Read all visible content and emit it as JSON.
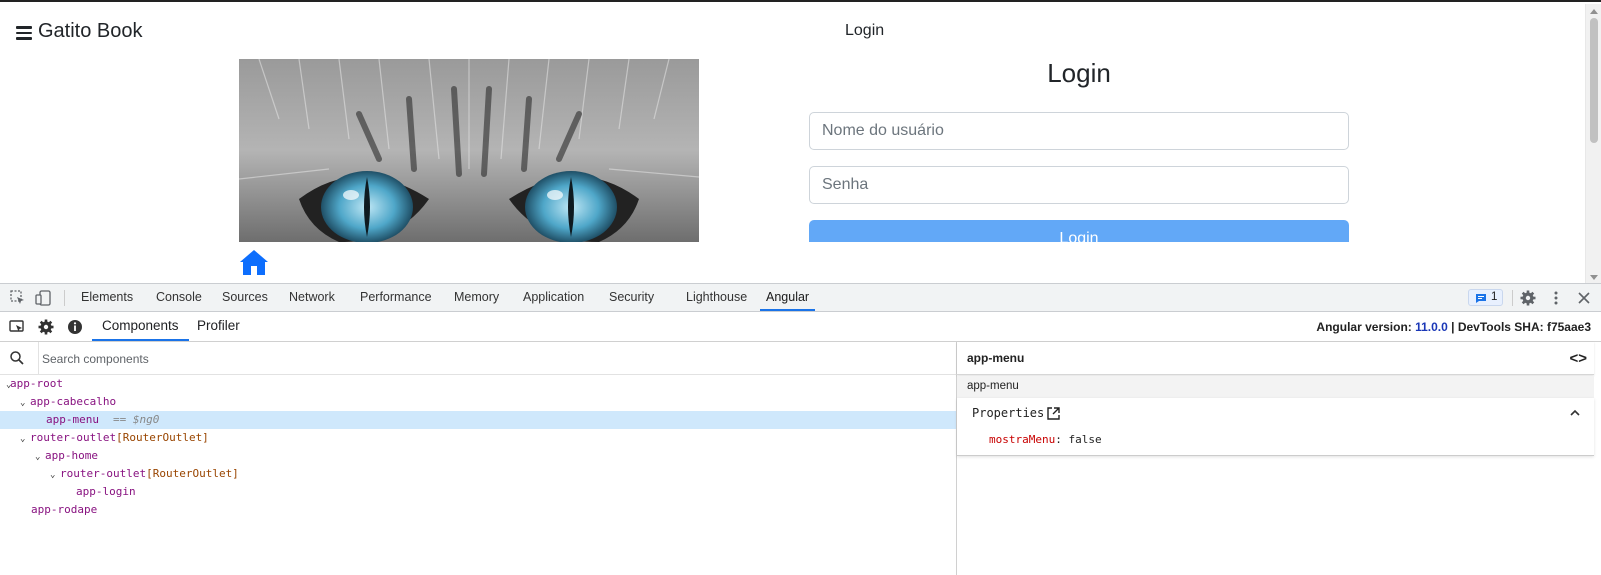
{
  "app": {
    "brand": "Gatito Book",
    "header_title": "Login",
    "login_title": "Login",
    "username_placeholder": "Nome do usuário",
    "password_placeholder": "Senha",
    "login_button": "Login",
    "colors": {
      "primary": "#0d6efd",
      "button": "#62a8f7"
    }
  },
  "devtools": {
    "tabs": [
      "Elements",
      "Console",
      "Sources",
      "Network",
      "Performance",
      "Memory",
      "Application",
      "Security",
      "Lighthouse",
      "Angular"
    ],
    "active_tab": "Angular",
    "issues_count": "1",
    "angular": {
      "tabs": [
        "Components",
        "Profiler"
      ],
      "active_tab": "Components",
      "version_label": "Angular version: ",
      "version": "11.0.0",
      "sha_label": " | DevTools SHA: f75aae3",
      "search_placeholder": "Search components",
      "tree": [
        {
          "name": "app-root",
          "directive": "",
          "expanded": true
        },
        {
          "name": "app-cabecalho",
          "directive": "",
          "expanded": true
        },
        {
          "name": "app-menu",
          "directive": "",
          "selected": true,
          "note": "== $ng0"
        },
        {
          "name": "router-outlet",
          "directive": "[RouterOutlet]",
          "expanded": true
        },
        {
          "name": "app-home",
          "directive": "",
          "expanded": true
        },
        {
          "name": "router-outlet",
          "directive": "[RouterOutlet]",
          "expanded": true
        },
        {
          "name": "app-login",
          "directive": ""
        },
        {
          "name": "app-rodape",
          "directive": ""
        }
      ],
      "details": {
        "component": "app-menu",
        "subheader": "app-menu",
        "section": "Properties",
        "property_key": "mostraMenu",
        "property_value": "false"
      }
    }
  }
}
